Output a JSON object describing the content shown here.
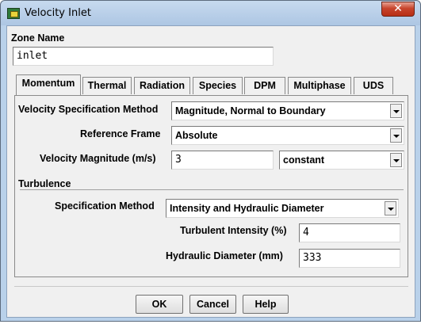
{
  "window": {
    "title": "Velocity Inlet",
    "close_glyph": "✕"
  },
  "zone": {
    "label": "Zone Name",
    "value": "inlet"
  },
  "tabs": [
    {
      "label": "Momentum",
      "active": true
    },
    {
      "label": "Thermal",
      "active": false
    },
    {
      "label": "Radiation",
      "active": false
    },
    {
      "label": "Species",
      "active": false
    },
    {
      "label": "DPM",
      "active": false
    },
    {
      "label": "Multiphase",
      "active": false
    },
    {
      "label": "UDS",
      "active": false
    }
  ],
  "momentum": {
    "velocity_spec_label": "Velocity Specification Method",
    "velocity_spec_value": "Magnitude, Normal to Boundary",
    "reference_frame_label": "Reference Frame",
    "reference_frame_value": "Absolute",
    "velocity_magnitude_label": "Velocity Magnitude (m/s)",
    "velocity_magnitude_value": "3",
    "velocity_magnitude_profile": "constant"
  },
  "turbulence": {
    "heading": "Turbulence",
    "spec_method_label": "Specification Method",
    "spec_method_value": "Intensity and Hydraulic Diameter",
    "intensity_label": "Turbulent Intensity (%)",
    "intensity_value": "4",
    "diameter_label": "Hydraulic Diameter (mm)",
    "diameter_value": "333"
  },
  "buttons": {
    "ok": "OK",
    "cancel": "Cancel",
    "help": "Help"
  }
}
